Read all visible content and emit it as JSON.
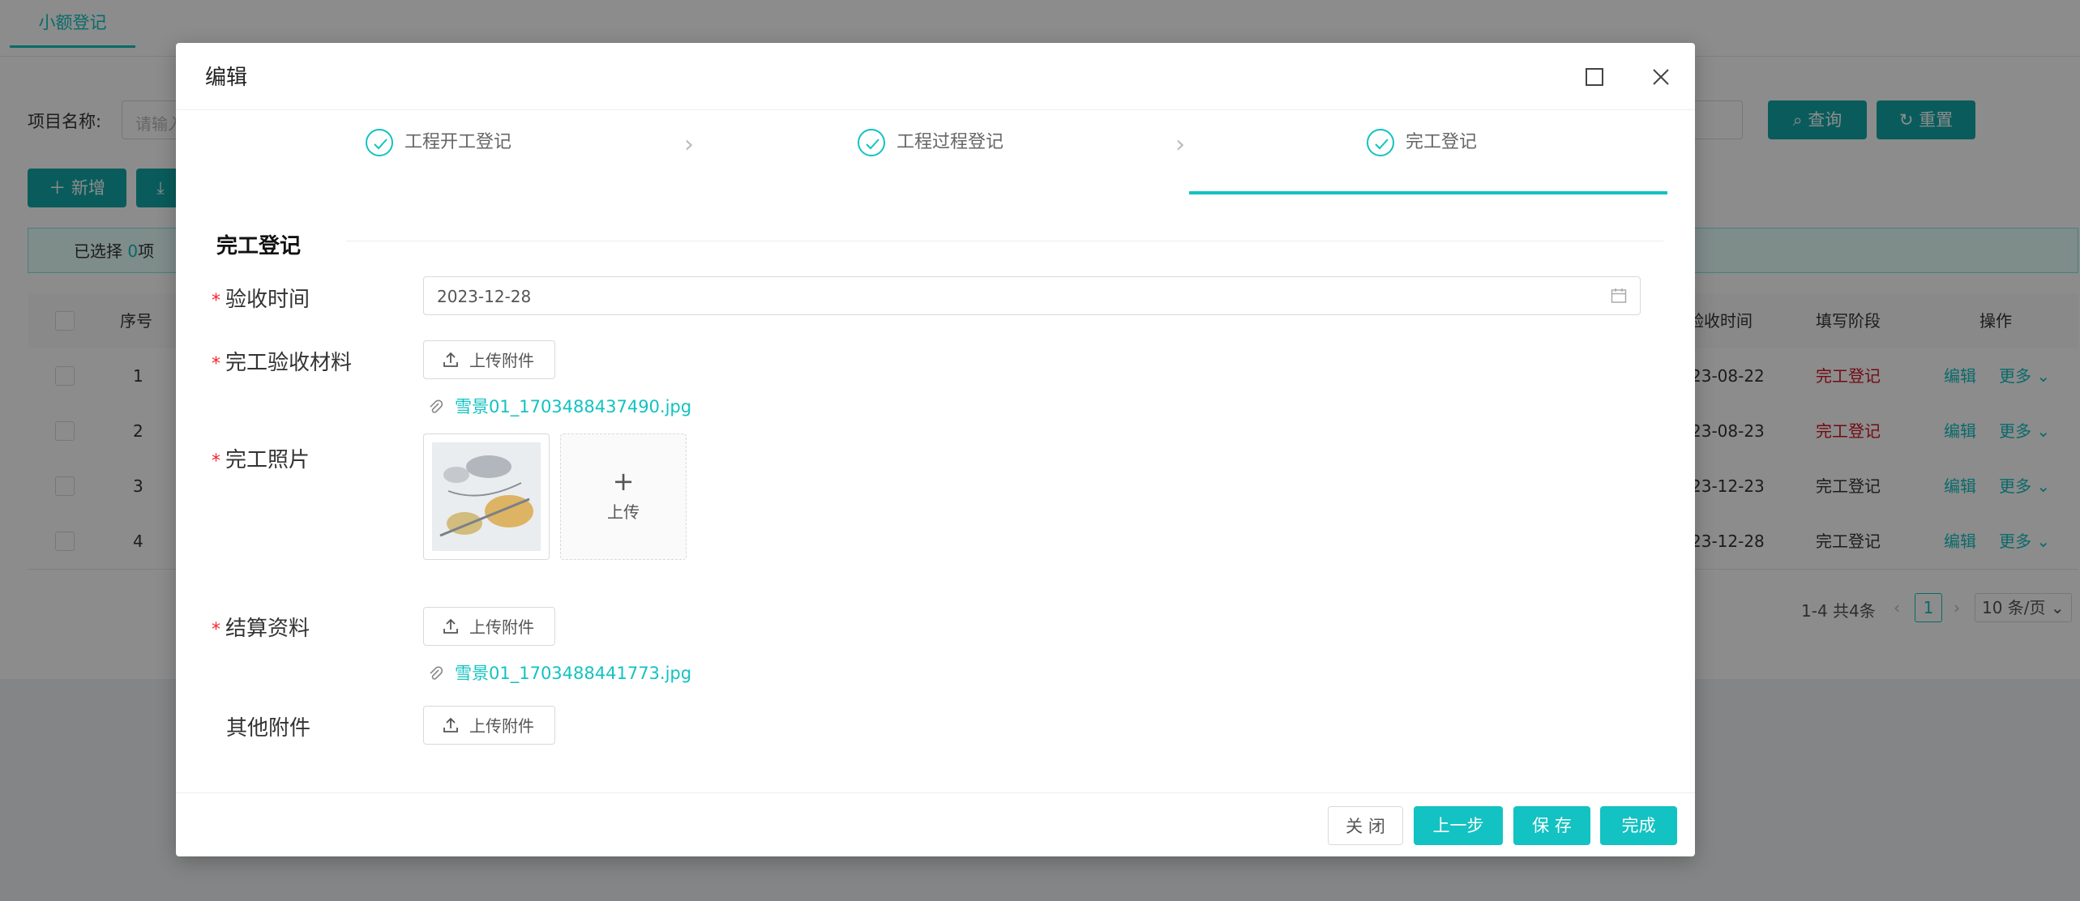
{
  "background": {
    "tab_label": "小额登记",
    "search_label": "项目名称:",
    "search_placeholder": "请输入",
    "query_button": "查询",
    "reset_button": "重置",
    "add_button": "新增",
    "selection_prefix": "已选择",
    "selection_count": "0",
    "selection_suffix": "项",
    "table": {
      "headers": {
        "index": "序号",
        "accept_time": "验收时间",
        "stage": "填写阶段",
        "actions": "操作"
      },
      "rows": [
        {
          "index": "1",
          "accept_time": "23-08-22",
          "stage": "完工登记",
          "stage_color": "#cf1322",
          "edit": "编辑",
          "more": "更多"
        },
        {
          "index": "2",
          "accept_time": "23-08-23",
          "stage": "完工登记",
          "stage_color": "#cf1322",
          "edit": "编辑",
          "more": "更多"
        },
        {
          "index": "3",
          "accept_time": "23-12-23",
          "stage": "完工登记",
          "stage_color": "#333333",
          "edit": "编辑",
          "more": "更多"
        },
        {
          "index": "4",
          "accept_time": "23-12-28",
          "stage": "完工登记",
          "stage_color": "#333333",
          "edit": "编辑",
          "more": "更多"
        }
      ]
    },
    "pager": {
      "total": "1-4 共4条",
      "current_page": "1",
      "page_size": "10 条/页"
    }
  },
  "modal": {
    "title": "编辑",
    "steps": [
      {
        "label": "工程开工登记"
      },
      {
        "label": "工程过程登记"
      },
      {
        "label": "完工登记"
      }
    ],
    "section_title": "完工登记",
    "fields": {
      "accept_time": {
        "label": "验收时间",
        "value": "2023-12-28"
      },
      "completion_materials": {
        "label": "完工验收材料",
        "button": "上传附件",
        "file": "雪景01_1703488437490.jpg"
      },
      "completion_photos": {
        "label": "完工照片",
        "upload_label": "上传"
      },
      "settlement": {
        "label": "结算资料",
        "button": "上传附件",
        "file": "雪景01_1703488441773.jpg"
      },
      "other": {
        "label": "其他附件",
        "button": "上传附件"
      }
    },
    "footer": {
      "close": "关 闭",
      "prev": "上一步",
      "save": "保 存",
      "finish": "完成"
    }
  },
  "colors": {
    "accent": "#13c2c2",
    "required": "#f5222d"
  }
}
